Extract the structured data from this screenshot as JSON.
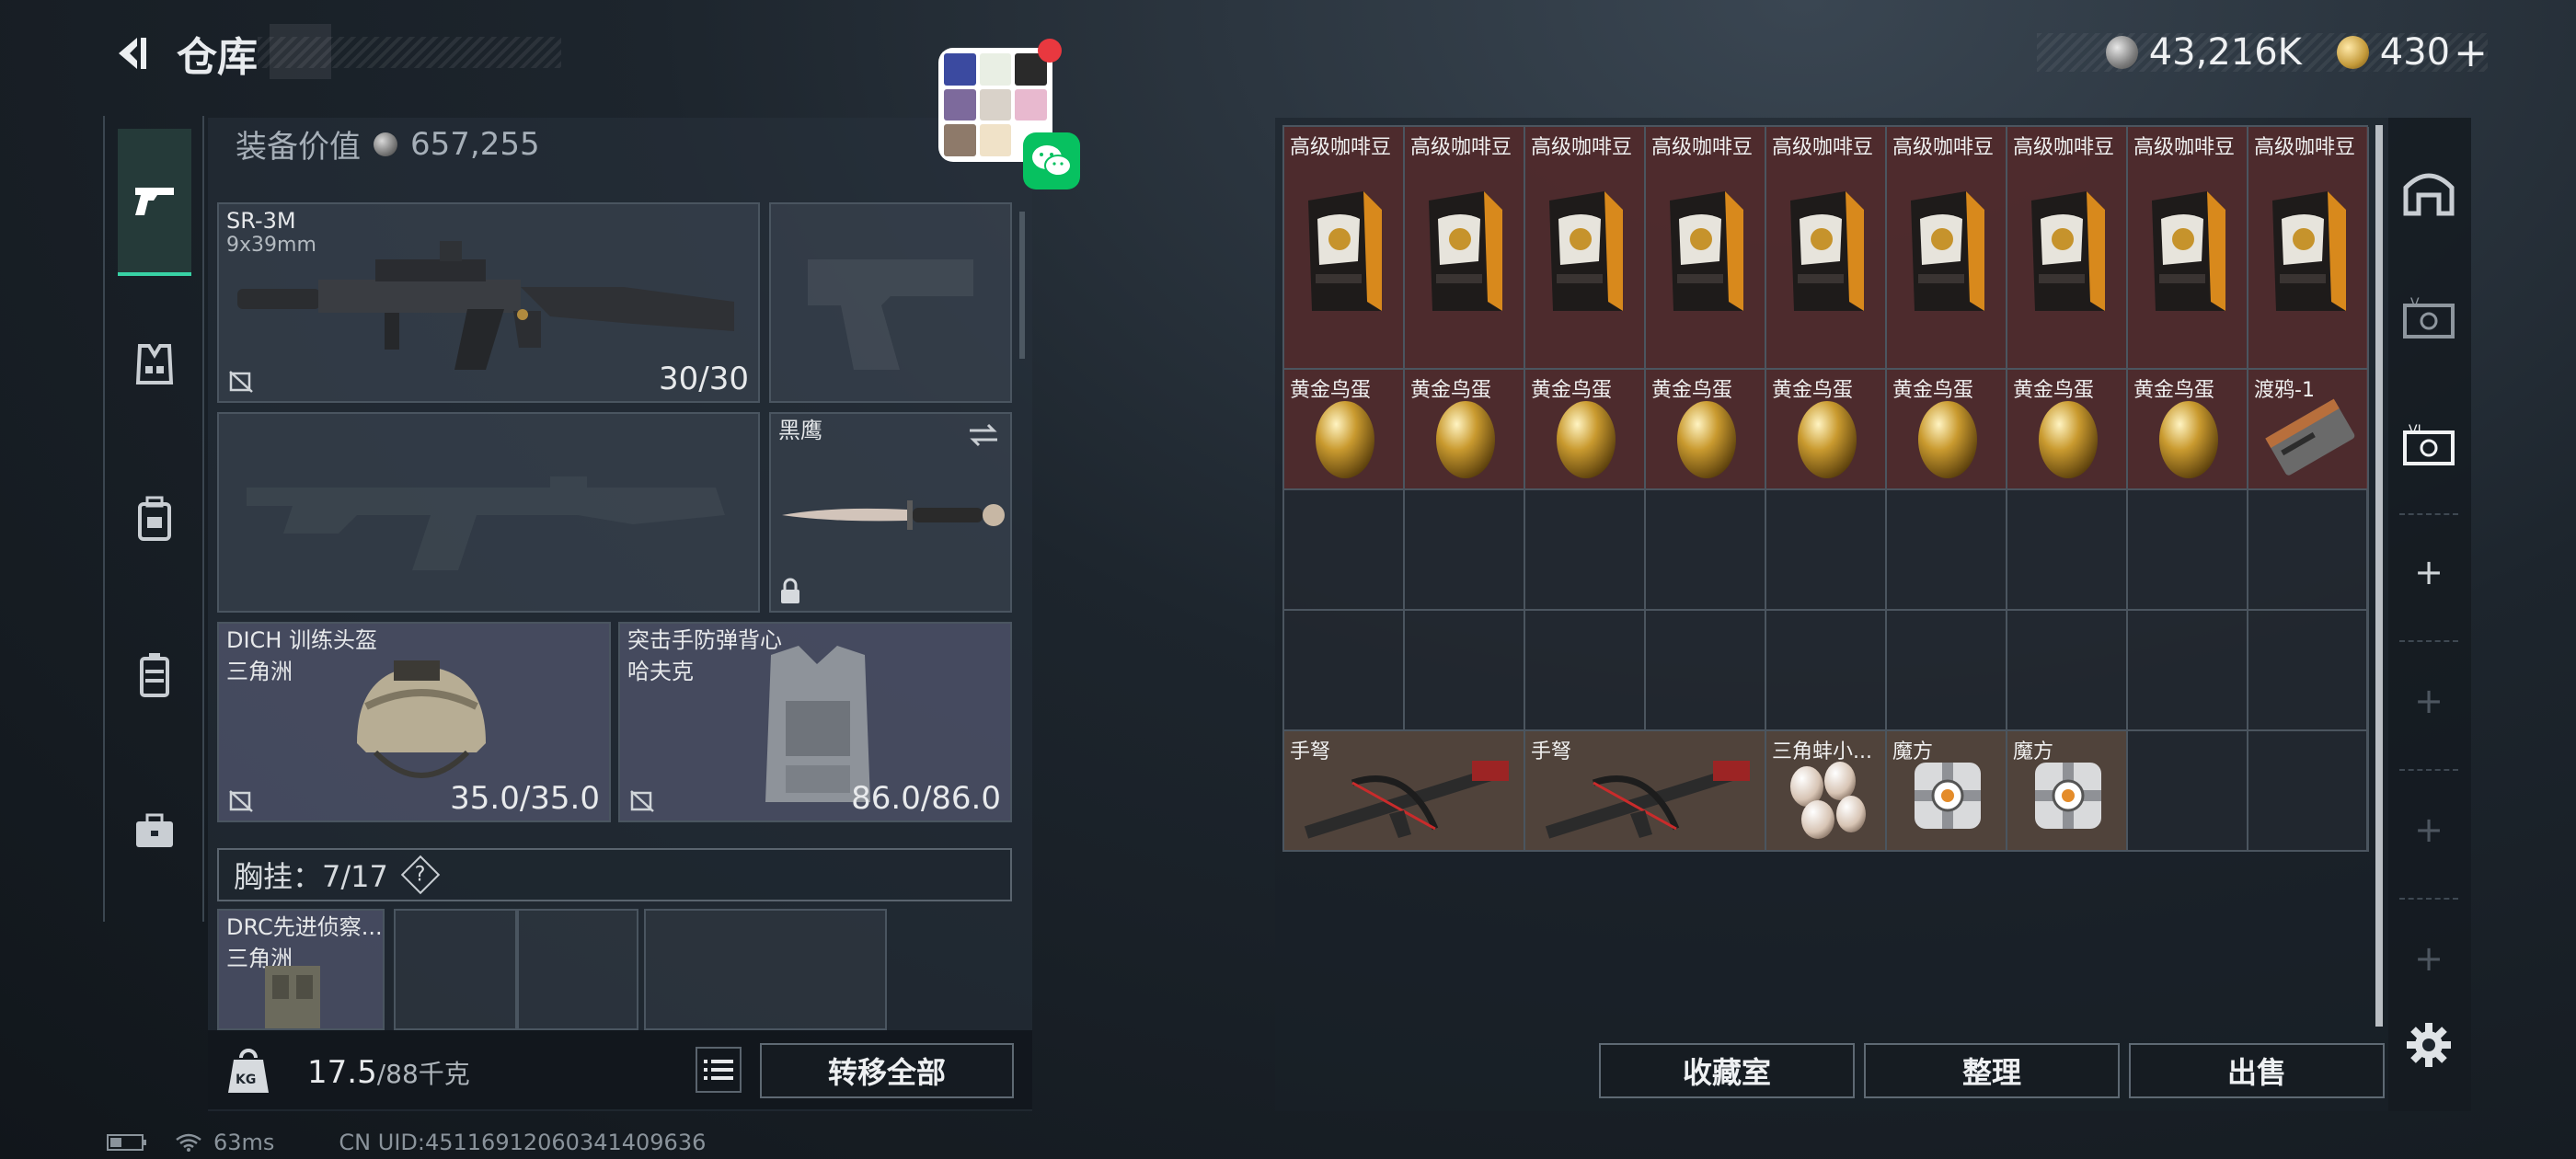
{
  "header": {
    "title": "仓库",
    "currency_1": "43,216K",
    "currency_2": "430",
    "add_label": "+"
  },
  "equip_value": {
    "label": "装备价值",
    "value": "657,255"
  },
  "slots": {
    "primary": {
      "name": "SR-3M",
      "ammo": "9x39mm",
      "durability": "30/30"
    },
    "melee": {
      "name": "黑鹰"
    },
    "helmet": {
      "name": "DICH 训练头盔",
      "origin": "三角洲",
      "durability": "35.0/35.0"
    },
    "armor": {
      "name": "突击手防弹背心",
      "origin": "哈夫克",
      "durability": "86.0/86.0"
    },
    "rig_item": {
      "name": "DRC先进侦察...",
      "origin": "三角洲"
    }
  },
  "chest": {
    "label": "胸挂：7/17",
    "help": "?"
  },
  "bottom": {
    "weight": "17.5",
    "capacity": "/88千克",
    "kg": "KG",
    "transfer_all": "转移全部"
  },
  "stash": {
    "row1": [
      "高级咖啡豆",
      "高级咖啡豆",
      "高级咖啡豆",
      "高级咖啡豆",
      "高级咖啡豆",
      "高级咖啡豆",
      "高级咖啡豆",
      "高级咖啡豆",
      "高级咖啡豆"
    ],
    "row2": [
      "黄金鸟蛋",
      "黄金鸟蛋",
      "黄金鸟蛋",
      "黄金鸟蛋",
      "黄金鸟蛋",
      "黄金鸟蛋",
      "黄金鸟蛋",
      "黄金鸟蛋",
      "渡鸦-1"
    ],
    "row5": [
      "手弩",
      "手弩",
      "三角蚌小...",
      "魔方",
      "魔方"
    ]
  },
  "actions": {
    "collection": "收藏室",
    "organize": "整理",
    "sell": "出售"
  },
  "status": {
    "ping": "63ms",
    "uid": "CN UID:45116912060341409636"
  },
  "colors": {
    "accent": "#38d2a5",
    "red_cell": "#5c2c2c",
    "brown_cell": "#604e40",
    "notification": "#e9383f",
    "wechat": "#07c160"
  },
  "icons": [
    "back-arrow-icon",
    "silver-coin-icon",
    "gold-coin-icon",
    "gun-icon",
    "vest-icon",
    "backpack-icon",
    "case-icon",
    "briefcase-icon",
    "lock-icon",
    "swap-icon",
    "no-insurance-icon",
    "list-icon",
    "kg-weight-icon",
    "gear-icon",
    "wechat-icon"
  ]
}
